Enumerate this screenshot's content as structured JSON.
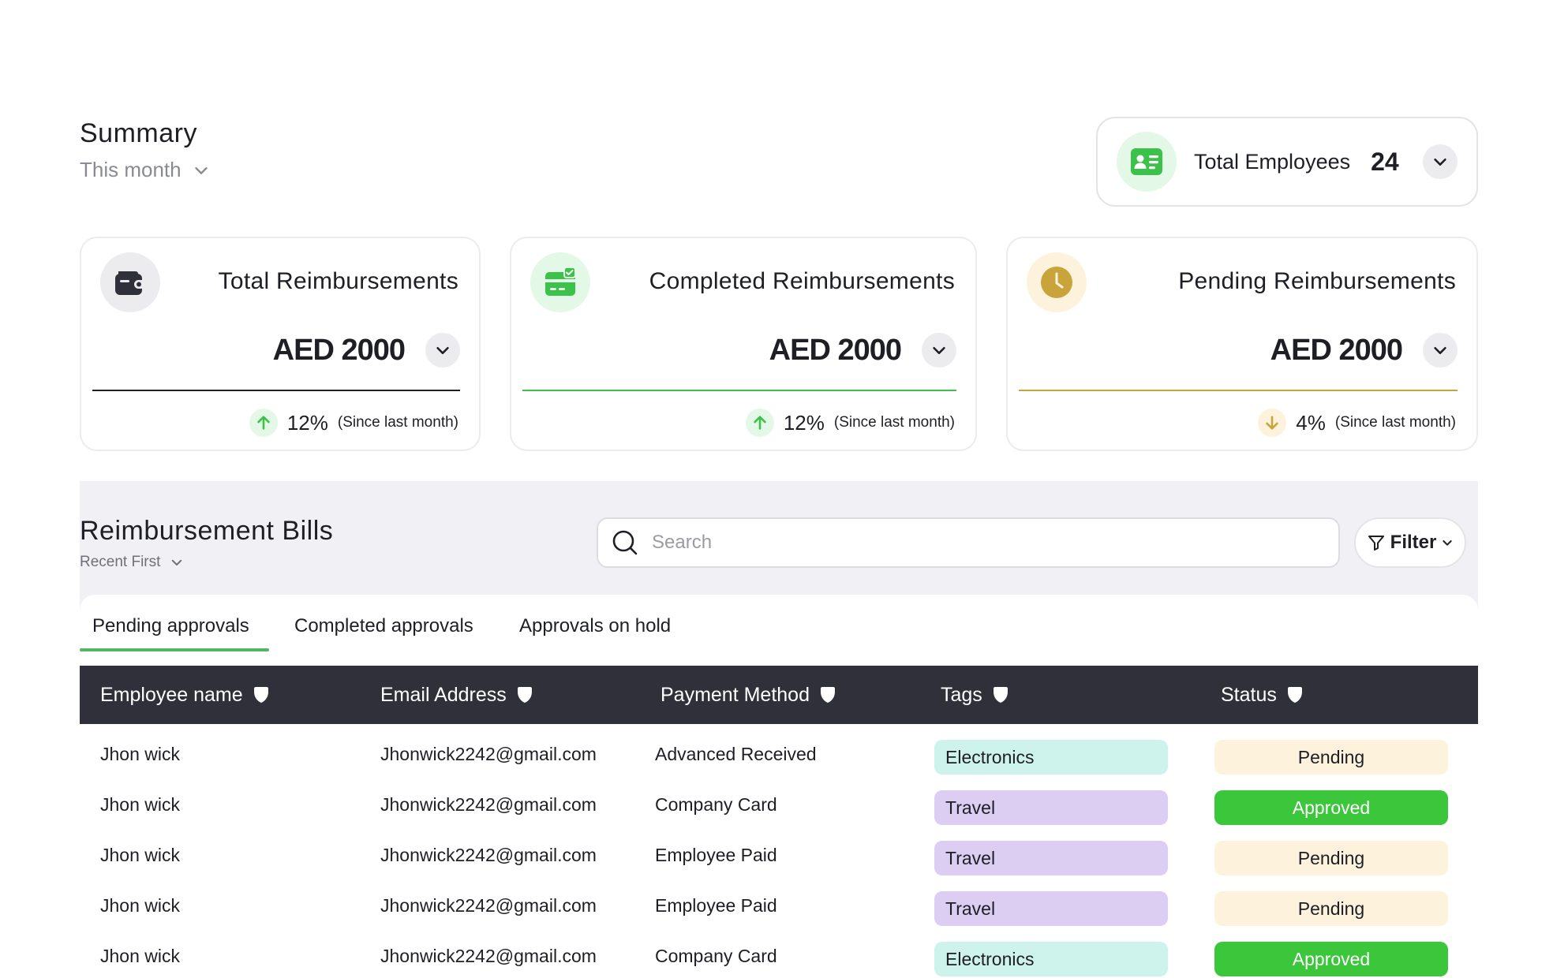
{
  "summary": {
    "title": "Summary",
    "period": "This month"
  },
  "employees": {
    "label": "Total Employees",
    "count": "24"
  },
  "stats": [
    {
      "title": "Total Reimbursements",
      "amount": "AED 2000",
      "change": "12%",
      "since": "(Since last month)",
      "trend": "up",
      "accent": "#1e1f24",
      "icon": "wallet-icon"
    },
    {
      "title": "Completed Reimbursements",
      "amount": "AED 2000",
      "change": "12%",
      "since": "(Since last month)",
      "trend": "up",
      "accent": "#3cc24a",
      "icon": "card-check-icon"
    },
    {
      "title": "Pending Reimbursements",
      "amount": "AED 2000",
      "change": "4%",
      "since": "(Since last month)",
      "trend": "down",
      "accent": "#c9a43a",
      "icon": "clock-icon"
    }
  ],
  "bills": {
    "title": "Reimbursement Bills",
    "sort": "Recent First",
    "search_placeholder": "Search",
    "filter_label": "Filter",
    "tabs": [
      "Pending approvals",
      "Completed approvals",
      "Approvals on hold"
    ],
    "active_tab": "Pending approvals",
    "columns": [
      "Employee name",
      "Email Address",
      "Payment Method",
      "Tags",
      "Status"
    ],
    "rows": [
      {
        "name": "Jhon wick",
        "email": "Jhonwick2242@gmail.com",
        "method": "Advanced Received",
        "tag": "Electronics",
        "status": "Pending"
      },
      {
        "name": "Jhon wick",
        "email": "Jhonwick2242@gmail.com",
        "method": "Company Card",
        "tag": "Travel",
        "status": "Approved"
      },
      {
        "name": "Jhon wick",
        "email": "Jhonwick2242@gmail.com",
        "method": "Employee Paid",
        "tag": "Travel",
        "status": "Pending"
      },
      {
        "name": "Jhon wick",
        "email": "Jhonwick2242@gmail.com",
        "method": "Employee Paid",
        "tag": "Travel",
        "status": "Pending"
      },
      {
        "name": "Jhon wick",
        "email": "Jhonwick2242@gmail.com",
        "method": "Company Card",
        "tag": "Electronics",
        "status": "Approved"
      }
    ]
  },
  "colors": {
    "tag_electronics": "#cdf3ec",
    "tag_travel": "#dccdf2",
    "status_pending_bg": "#fdf3dd",
    "status_approved_bg": "#3cc63c",
    "accent_green": "#52b664"
  }
}
